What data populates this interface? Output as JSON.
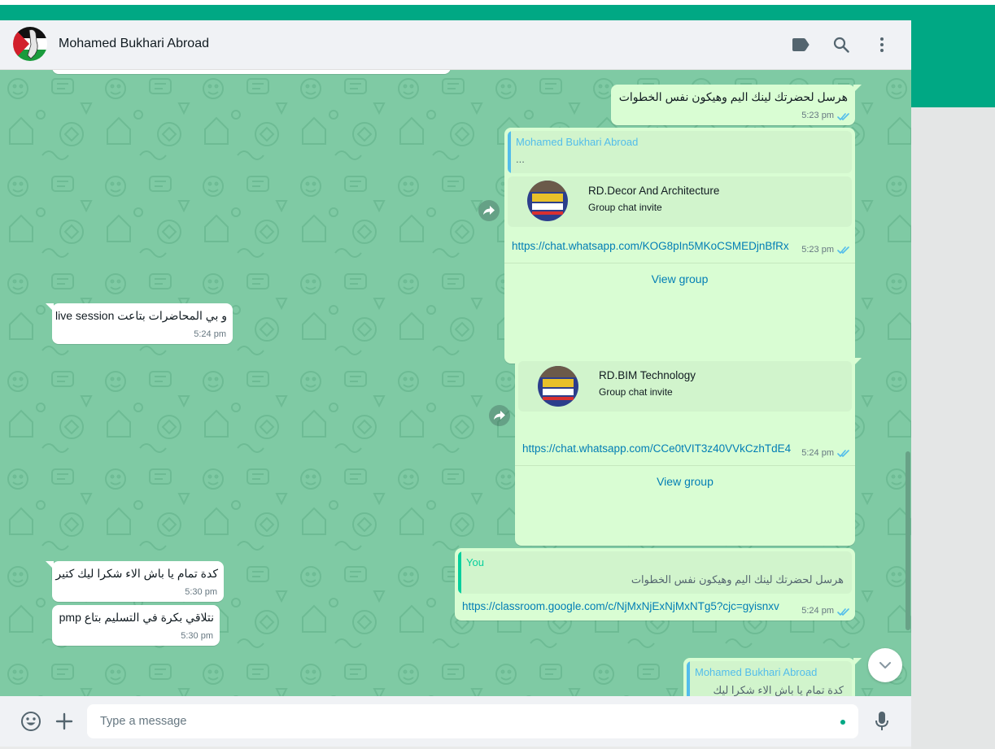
{
  "header": {
    "contact_name": "Mohamed Bukhari Abroad"
  },
  "messages": {
    "m1": {
      "text": "هرسل لحضرتك لينك اليم وهيكون نفس الخطوات",
      "time": "5:23 pm"
    },
    "m2": {
      "quote_author": "Mohamed Bukhari Abroad",
      "quote_text": "...",
      "group_title": "RD.Decor And Architecture",
      "group_sub": "Group chat invite",
      "link": "https://chat.whatsapp.com/KOG8pIn5MKoCSMEDjnBfRx",
      "time": "5:23 pm",
      "view_group": "View group"
    },
    "m3": {
      "text": "و بي المحاضرات بتاعت live session",
      "time": "5:24 pm"
    },
    "m4": {
      "group_title": "RD.BIM Technology",
      "group_sub": "Group chat invite",
      "link": "https://chat.whatsapp.com/CCe0tVIT3z40VVkCzhTdE4",
      "time": "5:24 pm",
      "view_group": "View group"
    },
    "m5": {
      "quote_author": "You",
      "quote_text": "هرسل لحضرتك لينك اليم وهيكون نفس الخطوات",
      "link": "https://classroom.google.com/c/NjMxNjExNjMxNTg5?cjc=gyisnxv",
      "time": "5:24 pm"
    },
    "m6": {
      "text": "كدة تمام يا باش الاء شكرا ليك كتير",
      "time": "5:30 pm"
    },
    "m7": {
      "text": "نتلاقي بكرة في التسليم بتاع pmp",
      "time": "5:30 pm"
    },
    "m8": {
      "quote_author": "Mohamed Bukhari Abroad",
      "quote_text": "كدة تمام يا باش الاء شكرا ليك كتير"
    }
  },
  "footer": {
    "placeholder": "Type a message"
  },
  "colors": {
    "accent": "#00a884",
    "chat_bg": "#7fcaa4",
    "outgoing_bubble": "#d9fdd3",
    "incoming_bubble": "#ffffff",
    "link": "#027eb5",
    "read_ticks": "#53bdeb",
    "quote_contact": "#53bdeb",
    "quote_you": "#06cf9c"
  }
}
